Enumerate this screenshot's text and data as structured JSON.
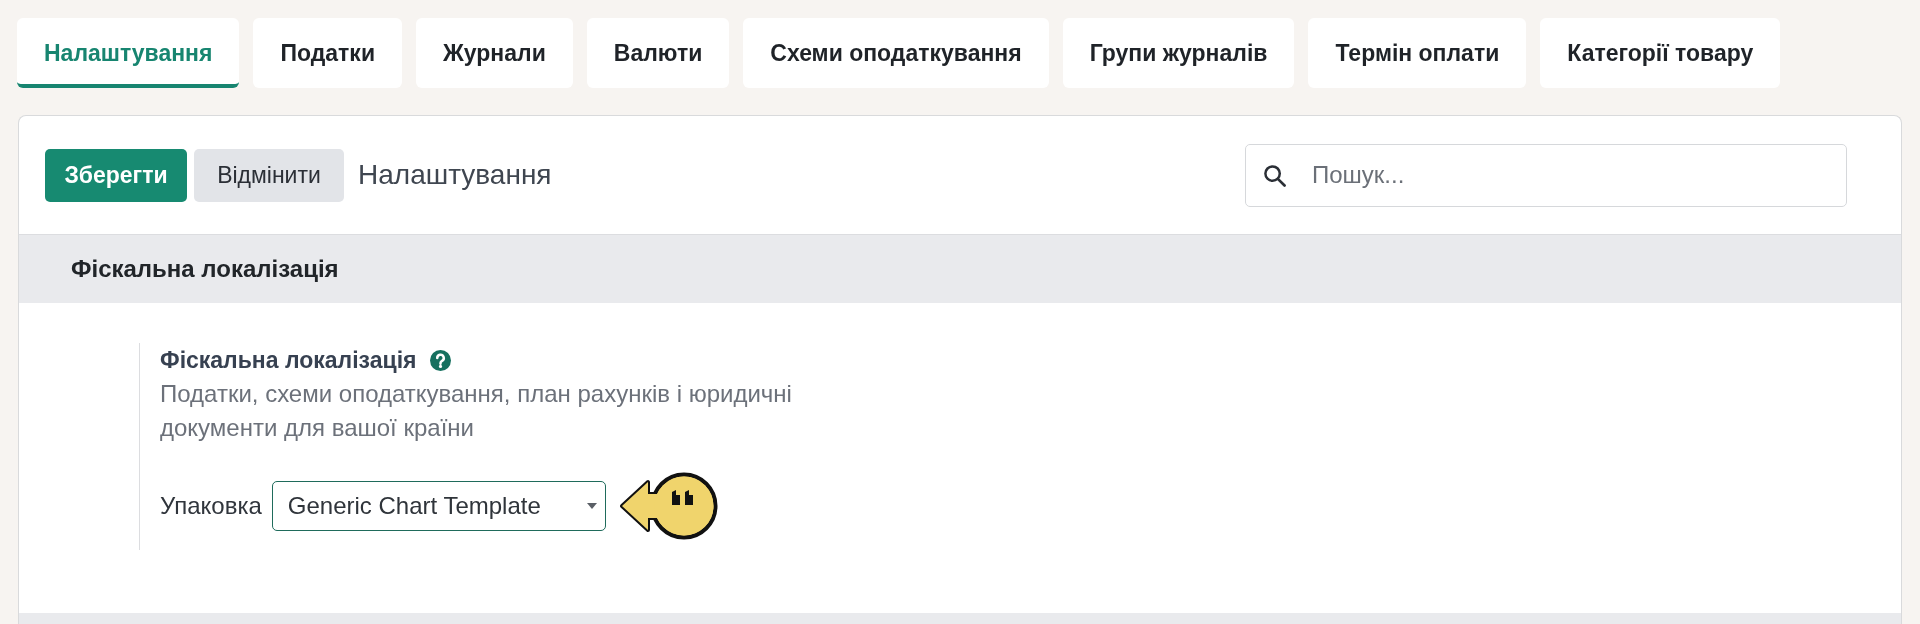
{
  "tabs": [
    {
      "label": "Налаштування",
      "selected": true
    },
    {
      "label": "Податки",
      "selected": false
    },
    {
      "label": "Журнали",
      "selected": false
    },
    {
      "label": "Валюти",
      "selected": false
    },
    {
      "label": "Схеми оподаткування",
      "selected": false
    },
    {
      "label": "Групи журналів",
      "selected": false
    },
    {
      "label": "Термін оплати",
      "selected": false
    },
    {
      "label": "Категорії товару",
      "selected": false
    }
  ],
  "toolbar": {
    "buttons": [
      {
        "label": "Зберегти",
        "kind": "primary"
      },
      {
        "label": "Відмінити",
        "kind": "secondary"
      }
    ],
    "title": "Налаштування",
    "search": {
      "placeholder": "Пошук..."
    }
  },
  "sections": [
    {
      "title": "Фіскальна локалізація",
      "settings": [
        {
          "title": "Фіскальна локалізація",
          "description": "Податки, схеми оподаткування, план рахунків і юридичні документи для вашої країни",
          "field": {
            "label": "Упаковка",
            "value": "Generic Chart Template"
          }
        }
      ]
    }
  ]
}
